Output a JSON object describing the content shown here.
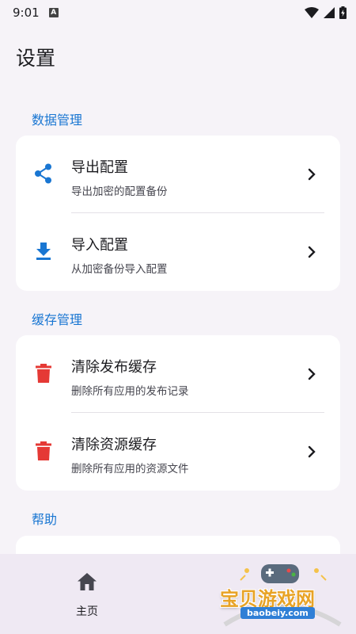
{
  "status_bar": {
    "time": "9:01",
    "notification_letter": "A"
  },
  "page_title": "设置",
  "sections": [
    {
      "header": "数据管理",
      "items": [
        {
          "icon": "share-icon",
          "title": "导出配置",
          "subtitle": "导出加密的配置备份"
        },
        {
          "icon": "download-icon",
          "title": "导入配置",
          "subtitle": "从加密备份导入配置"
        }
      ]
    },
    {
      "header": "缓存管理",
      "items": [
        {
          "icon": "trash-icon",
          "title": "清除发布缓存",
          "subtitle": "删除所有应用的发布记录"
        },
        {
          "icon": "trash-icon",
          "title": "清除资源缓存",
          "subtitle": "删除所有应用的资源文件"
        }
      ]
    },
    {
      "header": "帮助",
      "items": []
    }
  ],
  "bottom_nav": {
    "home_label": "主页"
  },
  "watermark": {
    "title": "宝贝游戏网",
    "url": "baobeiy.com"
  },
  "colors": {
    "accent": "#1976d2",
    "danger": "#e53935",
    "background": "#f6f3f8",
    "card": "#ffffff",
    "nav": "#efe9f3"
  }
}
